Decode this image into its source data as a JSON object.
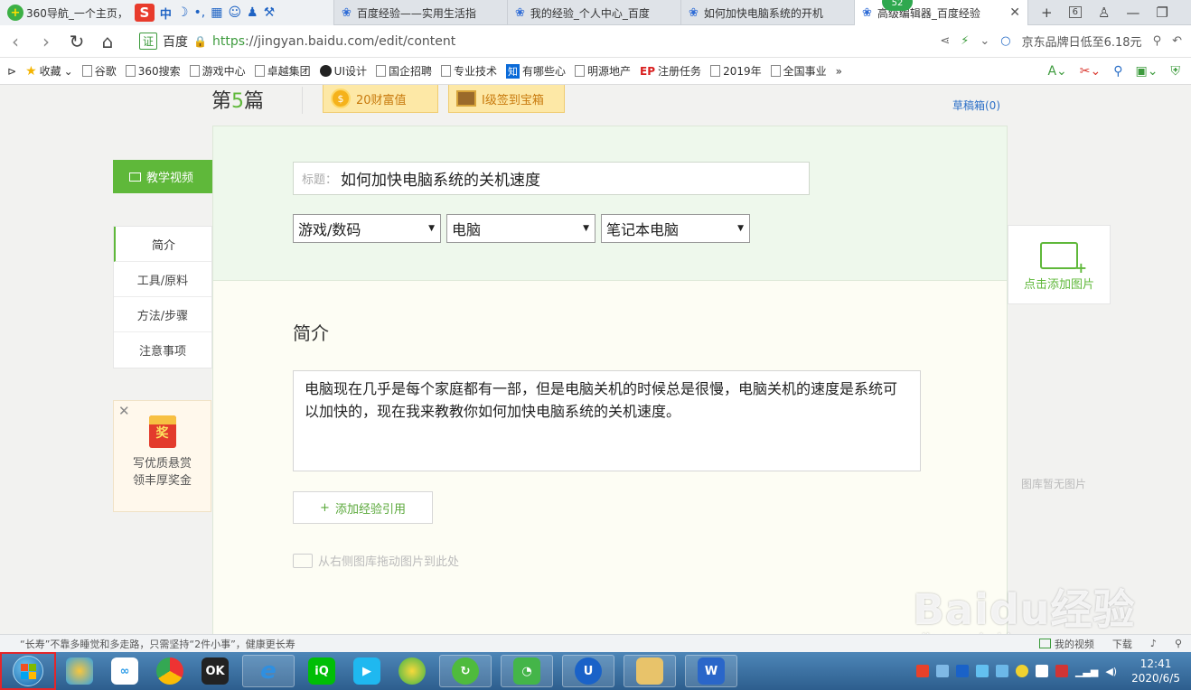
{
  "browser": {
    "home_tab": {
      "title": "360导航_一个主页，"
    },
    "ime": {
      "brand": "S",
      "mode": "中"
    },
    "tabs": [
      {
        "title": "百度经验——实用生活指"
      },
      {
        "title": "我的经验_个人中心_百度"
      },
      {
        "title": "如何加快电脑系统的开机"
      },
      {
        "title": "高级编辑器_百度经验",
        "badge": "52"
      }
    ],
    "tab_count": "6",
    "url": {
      "cert": "证",
      "site": "百度",
      "scheme": "https",
      "rest": "://jingyan.baidu.com/edit/content"
    },
    "search_ad": "京东品牌日低至6.18元",
    "bookmarks": [
      {
        "label": "收藏"
      },
      {
        "label": "谷歌"
      },
      {
        "label": "360搜索"
      },
      {
        "label": "游戏中心"
      },
      {
        "label": "卓越集团"
      },
      {
        "label": "UI设计"
      },
      {
        "label": "国企招聘"
      },
      {
        "label": "专业技术"
      },
      {
        "label": "有哪些心"
      },
      {
        "label": "明源地产"
      },
      {
        "label": "注册任务"
      },
      {
        "label": "2019年"
      },
      {
        "label": "全国事业"
      }
    ]
  },
  "page": {
    "article_prefix": "第",
    "article_num": "5",
    "article_suffix": "篇",
    "wealth_label": "20财富值",
    "coin_glyph": "$",
    "chest_label": "I级签到宝箱",
    "draft_link": "草稿箱(0)",
    "video_button": "教学视频",
    "side_nav": [
      {
        "label": "简介"
      },
      {
        "label": "工具/原料"
      },
      {
        "label": "方法/步骤"
      },
      {
        "label": "注意事项"
      }
    ],
    "reward": {
      "badge": "奖",
      "line1": "写优质悬赏",
      "line2": "领丰厚奖金"
    },
    "editor": {
      "title_label": "标题：",
      "title_value": "如何加快电脑系统的关机速度",
      "categories": [
        "游戏/数码",
        "电脑",
        "笔记本电脑"
      ],
      "section_title": "简介",
      "intro_text": "电脑现在几乎是每个家庭都有一部，但是电脑关机的时候总是很慢，电脑关机的速度是系统可以加快的，现在我来教教你如何加快电脑系统的关机速度。",
      "add_quote": "添加经验引用",
      "drag_tip": "从右侧图库拖动图片到此处"
    },
    "image_panel": {
      "add_label": "点击添加图片",
      "empty_label": "图库暂无图片"
    },
    "watermark": {
      "logo": "Baidu经验",
      "url": "jingyan.baidu.com"
    }
  },
  "statusbar": {
    "news": "“长寿”不靠多睡觉和多走路，只需坚持“2件小事”，健康更长寿",
    "my_video": "我的视频",
    "download": "下载"
  },
  "taskbar": {
    "clock_time": "12:41",
    "clock_date": "2020/6/5",
    "apps": [
      "360-browser",
      "baidu-netdisk",
      "chrome",
      "video-app",
      "ie",
      "iqiyi",
      "video-player",
      "360-safe",
      "360-browser-active",
      "wechat",
      "u-app",
      "file-explorer",
      "wps"
    ]
  },
  "colors": {
    "brand_green": "#5fb83a",
    "link_blue": "#2b6fc7",
    "editor_top": "#eef8ec",
    "editor_body": "#fdfdf4"
  }
}
